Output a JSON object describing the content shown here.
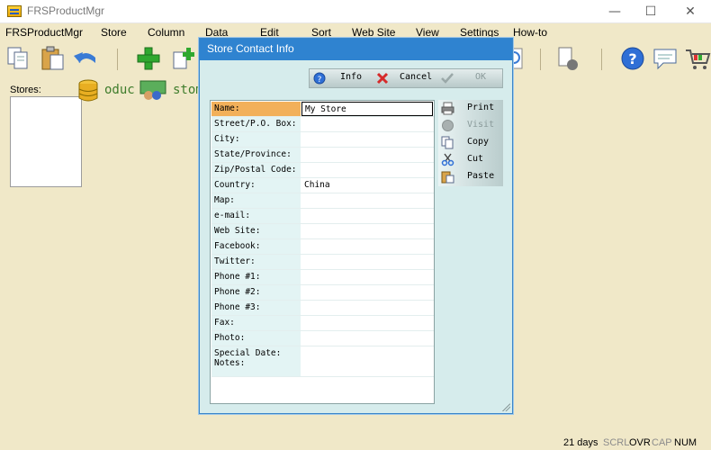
{
  "window": {
    "title": "FRSProductMgr",
    "min_glyph": "—",
    "max_glyph": "☐",
    "close_glyph": "✕"
  },
  "menu": {
    "items": [
      "FRSProductMgr",
      "Store",
      "Column",
      "Data",
      "Edit",
      "Sort",
      "Web Site",
      "View",
      "Settings",
      "How-to"
    ]
  },
  "toolbar": {
    "icons": [
      "copy-icon",
      "paste-icon",
      "undo-icon",
      "add-icon",
      "add-copy-icon",
      "search-icon",
      "export-icon",
      "help-icon",
      "chat-icon",
      "cart-icon"
    ]
  },
  "left_panel": {
    "stores_label": "Stores:",
    "bg_text_1": "oduc",
    "bg_text_2": "stom"
  },
  "dialog": {
    "title": "Store Contact Info",
    "buttons": {
      "info": "Info",
      "cancel": "Cancel",
      "ok": "OK"
    },
    "fields": [
      {
        "label": "Name:",
        "value": "My Store"
      },
      {
        "label": "Street/P.O. Box:",
        "value": ""
      },
      {
        "label": "City:",
        "value": ""
      },
      {
        "label": "State/Province:",
        "value": ""
      },
      {
        "label": "Zip/Postal Code:",
        "value": ""
      },
      {
        "label": "Country:",
        "value": "China"
      },
      {
        "label": "Map:",
        "value": ""
      },
      {
        "label": "e-mail:",
        "value": ""
      },
      {
        "label": "Web Site:",
        "value": ""
      },
      {
        "label": "Facebook:",
        "value": ""
      },
      {
        "label": "Twitter:",
        "value": ""
      },
      {
        "label": "Phone #1:",
        "value": ""
      },
      {
        "label": "Phone #2:",
        "value": ""
      },
      {
        "label": "Phone #3:",
        "value": ""
      },
      {
        "label": "Fax:",
        "value": ""
      },
      {
        "label": "Photo:",
        "value": ""
      },
      {
        "label": "Special Date:",
        "label2": "Notes:",
        "value": ""
      }
    ],
    "side_buttons": {
      "print": "Print",
      "visit": "Visit",
      "copy": "Copy",
      "cut": "Cut",
      "paste": "Paste"
    }
  },
  "status": {
    "days": "21 days",
    "scrl": "SCRL",
    "ovr": "OVR",
    "cap": "CAP",
    "num": "NUM"
  },
  "colors": {
    "app_background": "#f0e8c8",
    "dialog_title": "#2f83d0",
    "dialog_background": "#d6ecec",
    "active_label": "#f2b05a"
  }
}
